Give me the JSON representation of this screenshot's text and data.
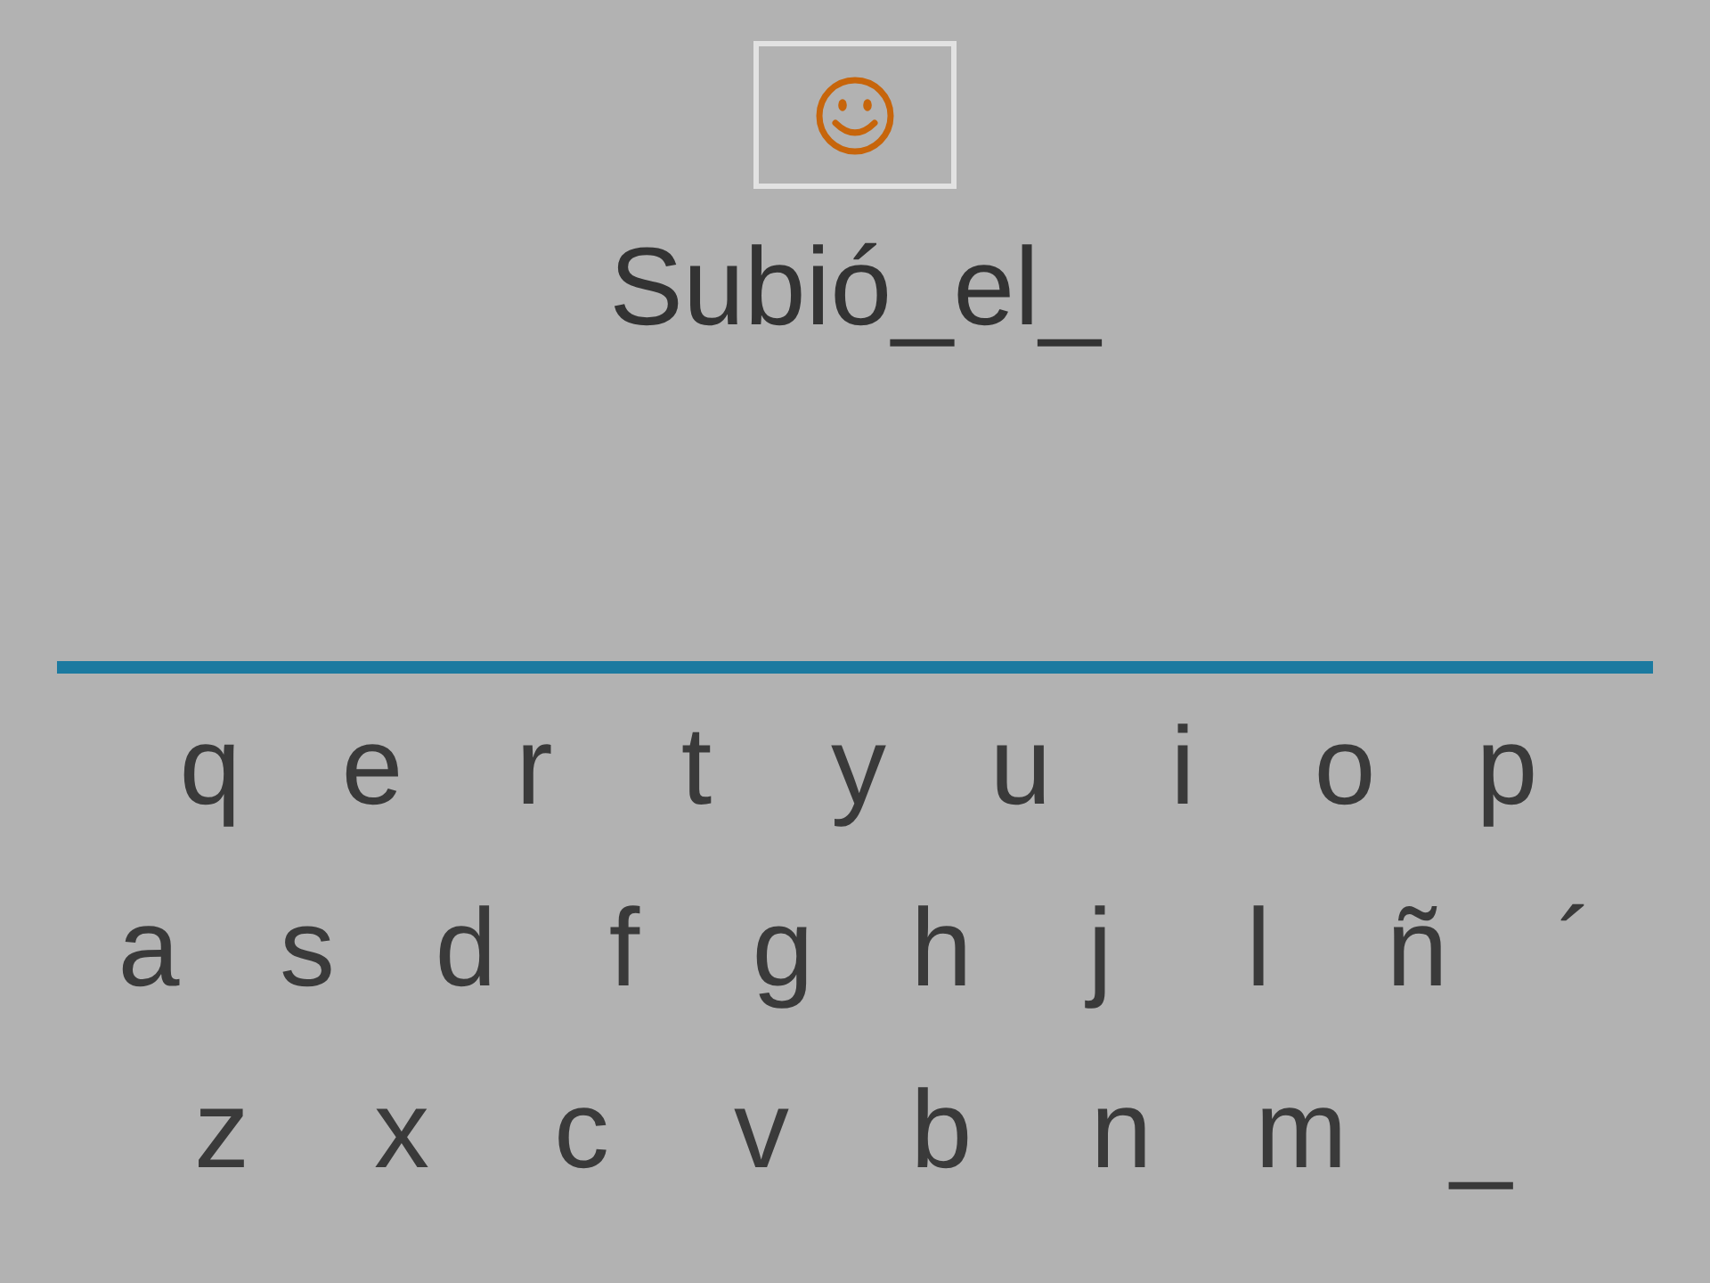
{
  "prompt": "Subió_el_",
  "keyboard": {
    "rows": [
      [
        "q",
        "e",
        "r",
        "t",
        "y",
        "u",
        "i",
        "o",
        "p"
      ],
      [
        "a",
        "s",
        "d",
        "f",
        "g",
        "h",
        "j",
        "l",
        "ñ",
        "´"
      ],
      [
        "z",
        "x",
        "c",
        "v",
        "b",
        "n",
        "m",
        "_"
      ]
    ]
  }
}
